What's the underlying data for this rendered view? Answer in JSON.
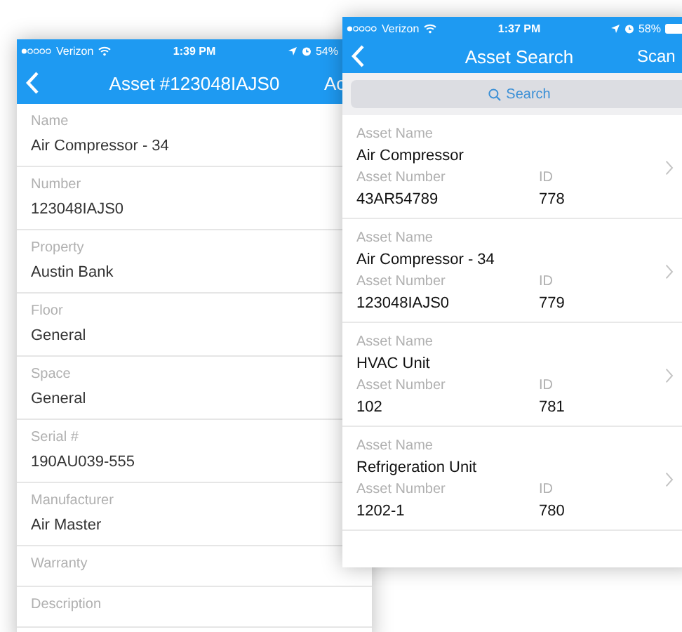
{
  "left_screen": {
    "status_bar": {
      "carrier": "Verizon",
      "time": "1:39 PM",
      "battery": "54%"
    },
    "nav_bar": {
      "title": "Asset #123048IAJS0",
      "action": "Ac"
    },
    "fields": [
      {
        "label": "Name",
        "value": "Air Compressor - 34"
      },
      {
        "label": "Number",
        "value": "123048IAJS0"
      },
      {
        "label": "Property",
        "value": "Austin Bank"
      },
      {
        "label": "Floor",
        "value": "General"
      },
      {
        "label": "Space",
        "value": "General"
      },
      {
        "label": "Serial #",
        "value": "190AU039-555"
      },
      {
        "label": "Manufacturer",
        "value": "Air Master"
      },
      {
        "label": "Warranty"
      },
      {
        "label": "Description"
      }
    ]
  },
  "right_screen": {
    "status_bar": {
      "carrier": "Verizon",
      "time": "1:37 PM",
      "battery": "58%"
    },
    "nav_bar": {
      "title": "Asset Search",
      "action": "Scan"
    },
    "search": {
      "placeholder": "Search"
    },
    "results": [
      {
        "name_label": "Asset Name",
        "name": "Air Compressor",
        "number_label": "Asset Number",
        "number": "43AR54789",
        "id_label": "ID",
        "id": "778"
      },
      {
        "name_label": "Asset Name",
        "name": "Air Compressor - 34",
        "number_label": "Asset Number",
        "number": "123048IAJS0",
        "id_label": "ID",
        "id": "779"
      },
      {
        "name_label": "Asset Name",
        "name": "HVAC Unit",
        "number_label": "Asset Number",
        "number": "102",
        "id_label": "ID",
        "id": "781"
      },
      {
        "name_label": "Asset Name",
        "name": "Refrigeration Unit",
        "number_label": "Asset Number",
        "number": "1202-1",
        "id_label": "ID",
        "id": "780"
      }
    ]
  }
}
